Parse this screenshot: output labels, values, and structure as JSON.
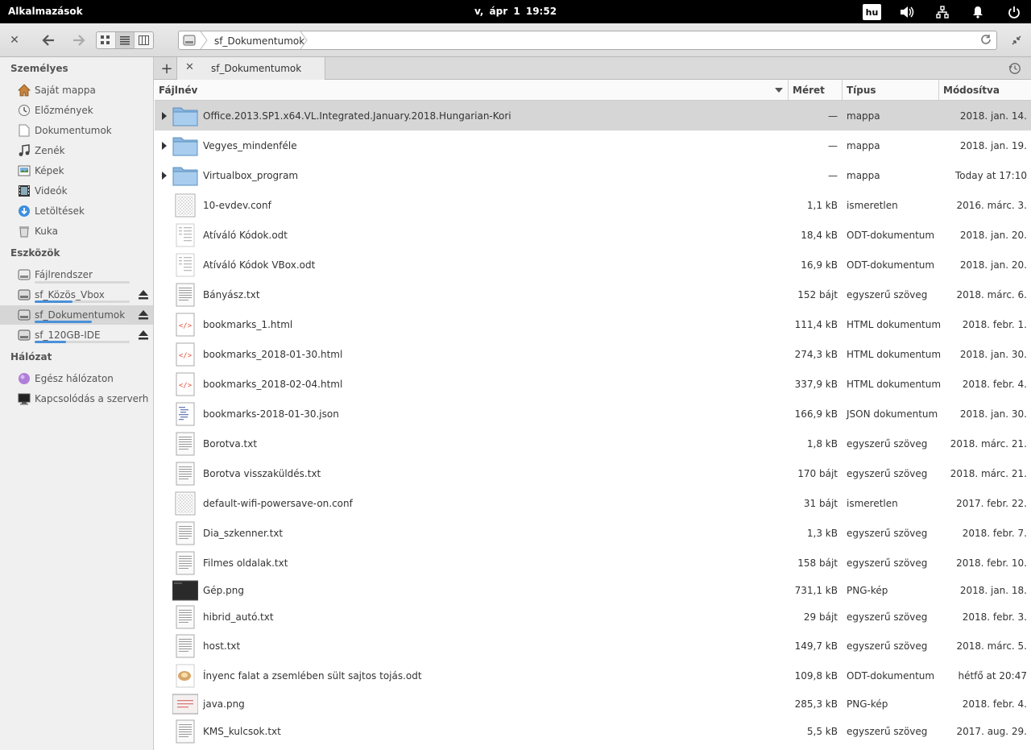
{
  "panel": {
    "apps_label": "Alkalmazások",
    "clock": "v, ápr 1   19:52",
    "keyboard_lang": "hu"
  },
  "pathbar": {
    "crumb": "sf_Dokumentumok"
  },
  "sidebar": {
    "sections": {
      "personal": "Személyes",
      "devices": "Eszközök",
      "network": "Hálózat"
    },
    "personal_items": [
      {
        "label": "Saját mappa",
        "icon": "home-icon"
      },
      {
        "label": "Előzmények",
        "icon": "recent-icon"
      },
      {
        "label": "Dokumentumok",
        "icon": "documents-icon"
      },
      {
        "label": "Zenék",
        "icon": "music-icon"
      },
      {
        "label": "Képek",
        "icon": "pictures-icon"
      },
      {
        "label": "Videók",
        "icon": "videos-icon"
      },
      {
        "label": "Letöltések",
        "icon": "downloads-icon"
      },
      {
        "label": "Kuka",
        "icon": "trash-icon"
      }
    ],
    "device_items": [
      {
        "label": "Fájlrendszer",
        "usage": 0.0
      },
      {
        "label": "sf_Közös_Vbox",
        "usage": 0.4
      },
      {
        "label": "sf_Dokumentumok",
        "usage": 0.6
      },
      {
        "label": "sf_120GB-IDE",
        "usage": 0.33
      }
    ],
    "network_items": [
      {
        "label": "Egész hálózaton",
        "icon": "network-icon"
      },
      {
        "label": "Kapcsolódás a szerverh...",
        "icon": "server-icon"
      }
    ]
  },
  "tab": {
    "label": "sf_Dokumentumok"
  },
  "columns": {
    "name": "Fájlnév",
    "size": "Méret",
    "type": "Típus",
    "modified": "Módosítva"
  },
  "files": [
    {
      "name": "Office.2013.SP1.x64.VL.Integrated.January.2018.Hungarian-Kori",
      "size": "—",
      "type": "mappa",
      "date": "2018. jan. 14.",
      "kind": "folder",
      "selected": true
    },
    {
      "name": "Vegyes_mindenféle",
      "size": "—",
      "type": "mappa",
      "date": "2018. jan. 19.",
      "kind": "folder"
    },
    {
      "name": "Virtualbox_program",
      "size": "—",
      "type": "mappa",
      "date": "Today at 17:10",
      "kind": "folder"
    },
    {
      "name": "10-evdev.conf",
      "size": "1,1 kB",
      "type": "ismeretlen",
      "date": "2016. márc.  3.",
      "kind": "unknown"
    },
    {
      "name": "Atíváló Kódok.odt",
      "size": "18,4 kB",
      "type": "ODT-dokumentum",
      "date": "2018. jan. 20.",
      "kind": "odt"
    },
    {
      "name": "Atíváló Kódok VBox.odt",
      "size": "16,9 kB",
      "type": "ODT-dokumentum",
      "date": "2018. jan. 20.",
      "kind": "odt"
    },
    {
      "name": "Bányász.txt",
      "size": "152 bájt",
      "type": "egyszerű szöveg",
      "date": "2018. márc.  6.",
      "kind": "txt"
    },
    {
      "name": "bookmarks_1.html",
      "size": "111,4 kB",
      "type": "HTML dokumentum",
      "date": "2018. febr.  1.",
      "kind": "html"
    },
    {
      "name": "bookmarks_2018-01-30.html",
      "size": "274,3 kB",
      "type": "HTML dokumentum",
      "date": "2018. jan. 30.",
      "kind": "html"
    },
    {
      "name": "bookmarks_2018-02-04.html",
      "size": "337,9 kB",
      "type": "HTML dokumentum",
      "date": "2018. febr.  4.",
      "kind": "html"
    },
    {
      "name": "bookmarks-2018-01-30.json",
      "size": "166,9 kB",
      "type": "JSON dokumentum",
      "date": "2018. jan. 30.",
      "kind": "json"
    },
    {
      "name": "Borotva.txt",
      "size": "1,8 kB",
      "type": "egyszerű szöveg",
      "date": "2018. márc. 21.",
      "kind": "txt"
    },
    {
      "name": "Borotva visszaküldés.txt",
      "size": "170 bájt",
      "type": "egyszerű szöveg",
      "date": "2018. márc. 21.",
      "kind": "txt"
    },
    {
      "name": "default-wifi-powersave-on.conf",
      "size": "31 bájt",
      "type": "ismeretlen",
      "date": "2017. febr. 22.",
      "kind": "unknown"
    },
    {
      "name": "Dia_szkenner.txt",
      "size": "1,3 kB",
      "type": "egyszerű szöveg",
      "date": "2018. febr.  7.",
      "kind": "txt"
    },
    {
      "name": "Filmes oldalak.txt",
      "size": "158 bájt",
      "type": "egyszerű szöveg",
      "date": "2018. febr. 10.",
      "kind": "txt"
    },
    {
      "name": "Gép.png",
      "size": "731,1 kB",
      "type": "PNG-kép",
      "date": "2018. jan. 18.",
      "kind": "png-dark"
    },
    {
      "name": "hibrid_autó.txt",
      "size": "29 bájt",
      "type": "egyszerű szöveg",
      "date": "2018. febr.  3.",
      "kind": "txt"
    },
    {
      "name": "host.txt",
      "size": "149,7 kB",
      "type": "egyszerű szöveg",
      "date": "2018. márc.  5.",
      "kind": "txt"
    },
    {
      "name": "Ínyenc falat a zsemlében sült sajtos tojás.odt",
      "size": "109,8 kB",
      "type": "ODT-dokumentum",
      "date": "hétfő at 20:47",
      "kind": "odt-img"
    },
    {
      "name": "java.png",
      "size": "285,3 kB",
      "type": "PNG-kép",
      "date": "2018. febr.  4.",
      "kind": "png-light"
    },
    {
      "name": "KMS_kulcsok.txt",
      "size": "5,5 kB",
      "type": "egyszerű szöveg",
      "date": "2017. aug. 29.",
      "kind": "txt"
    }
  ]
}
